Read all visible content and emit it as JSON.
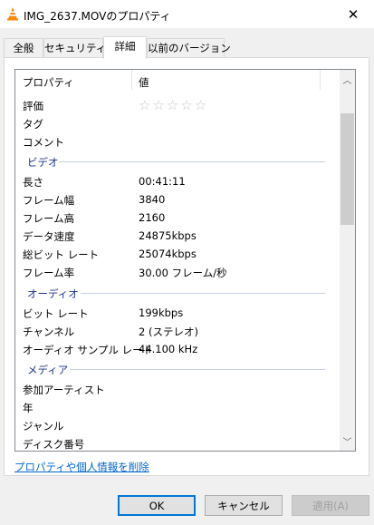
{
  "window": {
    "title": "IMG_2637.MOVのプロパティ",
    "close_symbol": "✕"
  },
  "tabs": [
    {
      "label": "全般"
    },
    {
      "label": "セキュリティ"
    },
    {
      "label": "詳細"
    },
    {
      "label": "以前のバージョン"
    }
  ],
  "active_tab": "詳細",
  "list": {
    "header": {
      "property": "プロパティ",
      "value": "値"
    },
    "rating": {
      "name": "評価",
      "stars": "☆☆☆☆☆",
      "value_stars": 0
    },
    "description": [
      {
        "name": "タグ",
        "value": ""
      },
      {
        "name": "コメント",
        "value": ""
      }
    ],
    "video": {
      "label": "ビデオ",
      "rows": [
        {
          "name": "長さ",
          "value": "00:41:11"
        },
        {
          "name": "フレーム幅",
          "value": "3840"
        },
        {
          "name": "フレーム高",
          "value": "2160"
        },
        {
          "name": "データ速度",
          "value": "24875kbps"
        },
        {
          "name": "総ビット レート",
          "value": "25074kbps"
        },
        {
          "name": "フレーム率",
          "value": "30.00 フレーム/秒"
        }
      ]
    },
    "audio": {
      "label": "オーディオ",
      "rows": [
        {
          "name": "ビット レート",
          "value": "199kbps"
        },
        {
          "name": "チャンネル",
          "value": "2 (ステレオ)"
        },
        {
          "name": "オーディオ サンプル レート",
          "value": "44.100 kHz"
        }
      ]
    },
    "media": {
      "label": "メディア",
      "rows": [
        {
          "name": "参加アーティスト",
          "value": ""
        },
        {
          "name": "年",
          "value": ""
        },
        {
          "name": "ジャンル",
          "value": ""
        },
        {
          "name": "ディスク番号",
          "value": ""
        }
      ]
    }
  },
  "scrollbar": {
    "up_symbol": "︿",
    "down_symbol": "﹀"
  },
  "remove_link": "プロパティや個人情報を削除",
  "buttons": {
    "ok": "OK",
    "cancel": "キャンセル",
    "apply": "適用(A)"
  },
  "colors": {
    "accent_blue": "#0078d7",
    "group_label": "#1e3287",
    "link": "#0066cc",
    "vlc_orange": "#ff8800"
  }
}
